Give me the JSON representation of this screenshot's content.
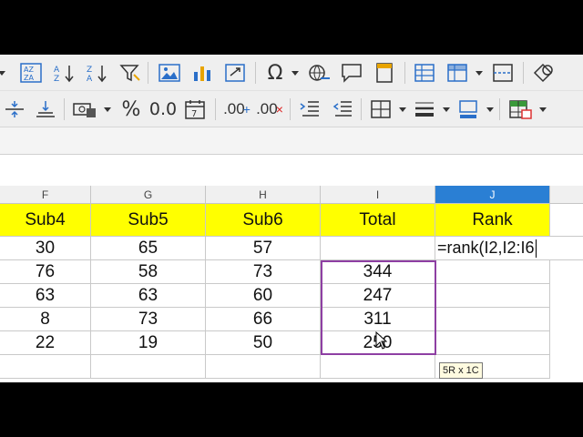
{
  "columns": [
    {
      "letter": "F",
      "header": "Sub4"
    },
    {
      "letter": "G",
      "header": "Sub5"
    },
    {
      "letter": "H",
      "header": "Sub6"
    },
    {
      "letter": "I",
      "header": "Total"
    },
    {
      "letter": "J",
      "header": "Rank"
    }
  ],
  "rows": [
    {
      "f": "30",
      "g": "65",
      "h": "57",
      "i": "",
      "j": "=rank(I2,I2:I6"
    },
    {
      "f": "76",
      "g": "58",
      "h": "73",
      "i": "344",
      "j": ""
    },
    {
      "f": "63",
      "g": "63",
      "h": "60",
      "i": "247",
      "j": ""
    },
    {
      "f": "8",
      "g": "73",
      "h": "66",
      "i": "311",
      "j": ""
    },
    {
      "f": "22",
      "g": "19",
      "h": "50",
      "i": "250",
      "j": ""
    }
  ],
  "selection_tooltip": "5R x 1C",
  "toolbar": {
    "percent": "%",
    "number": "0.0",
    "decimal_add": ".00",
    "decimal_remove": ".00",
    "special_char": "Ω"
  },
  "colors": {
    "header_fill": "#ffff00",
    "active_column": "#2a7fd4",
    "selection_border": "#8e3fa3"
  }
}
